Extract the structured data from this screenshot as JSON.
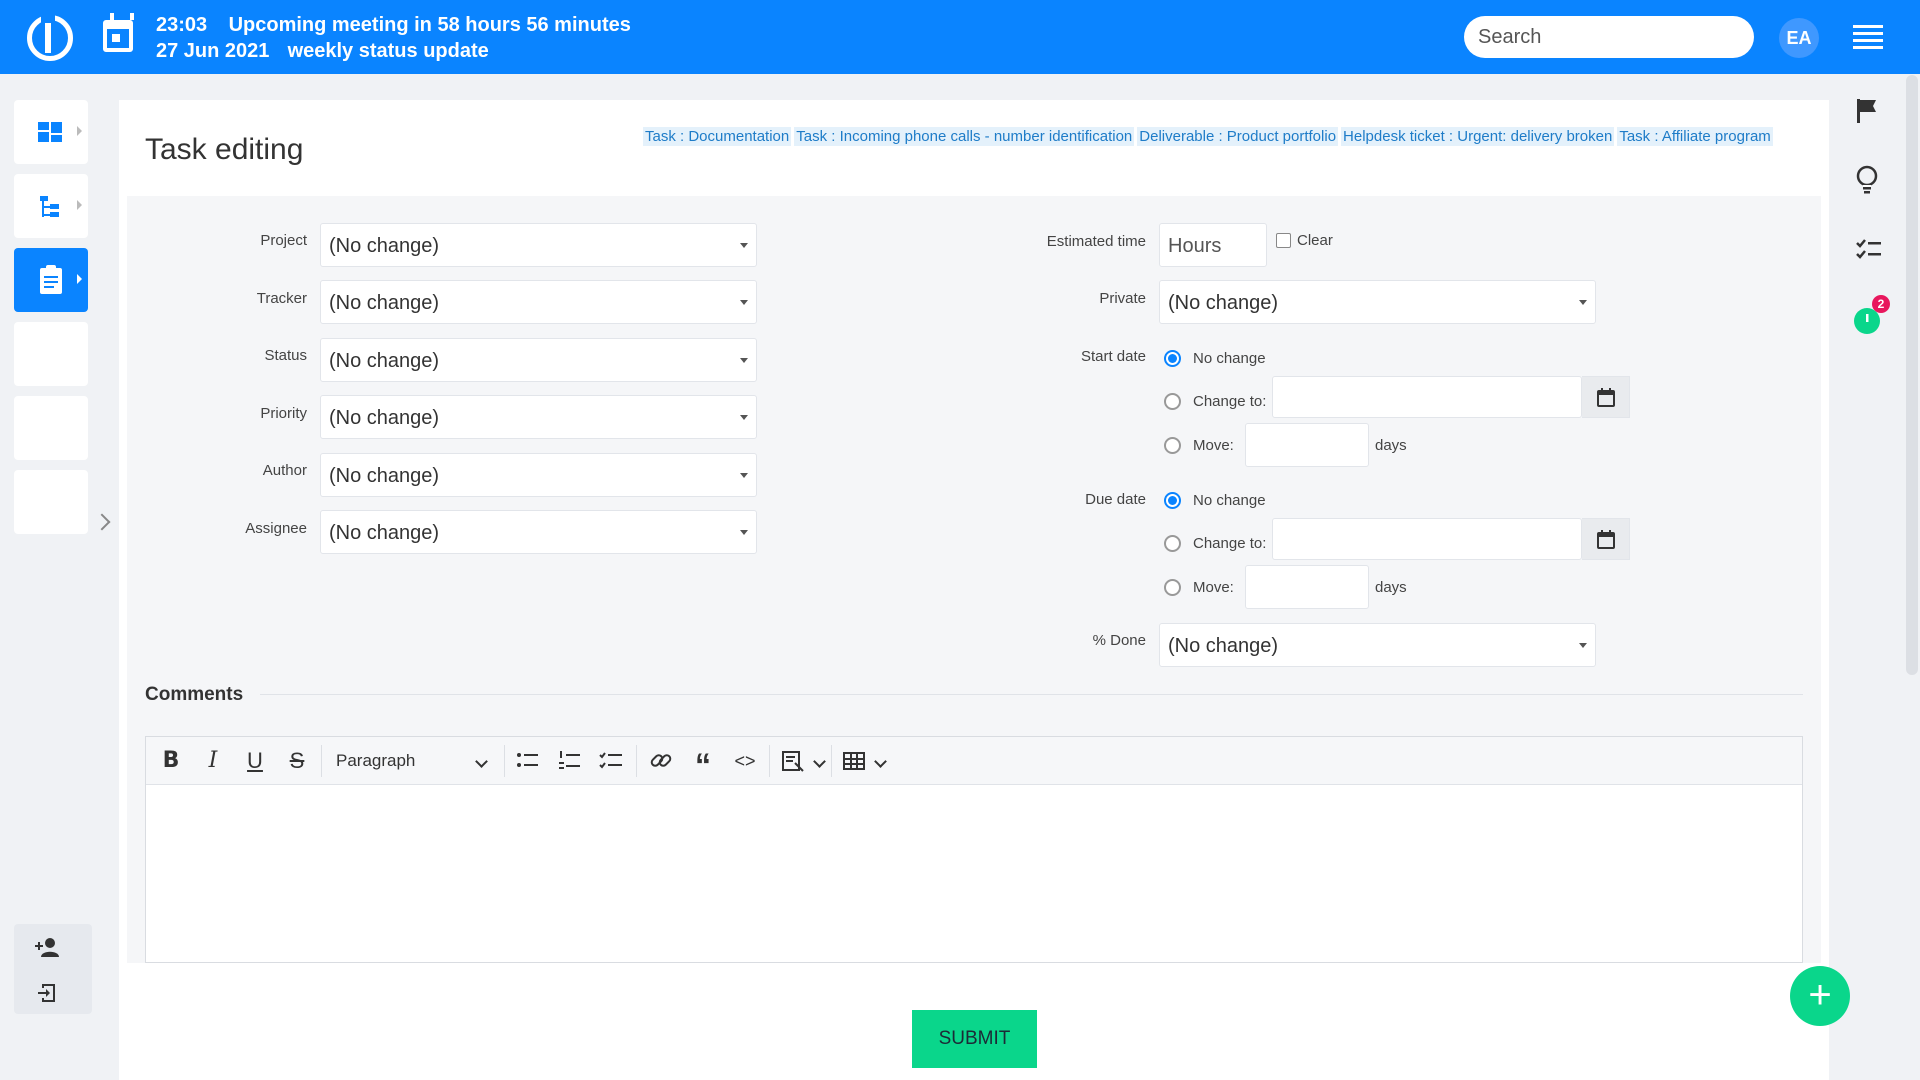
{
  "header": {
    "time": "23:03",
    "date": "27 Jun 2021",
    "meeting_text": "Upcoming meeting in 58 hours 56 minutes",
    "meeting_name": "weekly status update",
    "search_placeholder": "Search",
    "avatar_initials": "EA",
    "accent_color": "#0a84ff"
  },
  "page": {
    "title": "Task editing",
    "breadcrumbs": [
      "Task : Documentation",
      "Task : Incoming phone calls - number identification",
      "Deliverable : Product portfolio",
      "Helpdesk ticket : Urgent: delivery broken",
      "Task : Affiliate program"
    ]
  },
  "form": {
    "left_fields": [
      {
        "label": "Project",
        "value": "(No change)"
      },
      {
        "label": "Tracker",
        "value": "(No change)"
      },
      {
        "label": "Status",
        "value": "(No change)"
      },
      {
        "label": "Priority",
        "value": "(No change)"
      },
      {
        "label": "Author",
        "value": "(No change)"
      },
      {
        "label": "Assignee",
        "value": "(No change)"
      }
    ],
    "estimated_time": {
      "label": "Estimated time",
      "placeholder": "Hours",
      "clear_label": "Clear"
    },
    "private": {
      "label": "Private",
      "value": "(No change)"
    },
    "start_date": {
      "label": "Start date",
      "no_change": "No change",
      "change_to": "Change to:",
      "move": "Move:",
      "days": "days"
    },
    "due_date": {
      "label": "Due date",
      "no_change": "No change",
      "change_to": "Change to:",
      "move": "Move:",
      "days": "days"
    },
    "done": {
      "label": "% Done",
      "value": "(No change)"
    }
  },
  "comments": {
    "label": "Comments",
    "paragraph_label": "Paragraph"
  },
  "submit_label": "SUBMIT",
  "right_rail": {
    "notification_count": "2"
  },
  "icons": [
    "logo-icon",
    "calendar-icon",
    "menu-icon",
    "dashboard-icon",
    "tree-icon",
    "clipboard-icon",
    "flag-icon",
    "lightbulb-icon",
    "checklist-icon",
    "timer-icon",
    "add-user-icon",
    "logout-icon",
    "plus-icon"
  ]
}
